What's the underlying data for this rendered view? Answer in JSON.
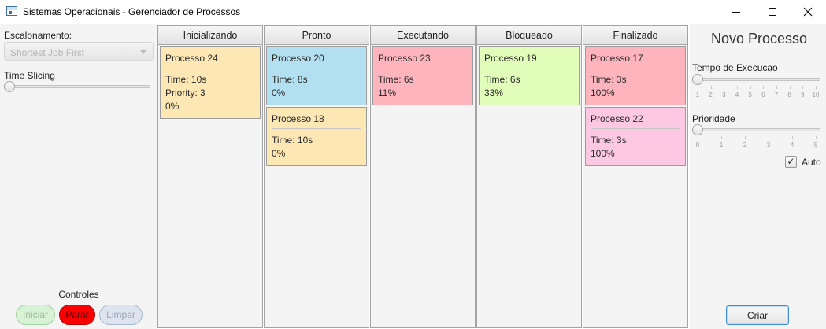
{
  "window": {
    "title": "Sistemas Operacionais - Gerenciador de Processos"
  },
  "left": {
    "scheduler_label": "Escalonamento:",
    "scheduler_value": "Shortest Job First",
    "time_slicing_label": "Time Slicing",
    "time_slicing_level": 0,
    "controls_label": "Controles",
    "buttons": {
      "start": "Iniciar",
      "stop": "Parar",
      "clear": "Limpar"
    }
  },
  "columns": [
    {
      "title": "Inicializando",
      "cards": [
        {
          "name": "Processo 24",
          "lines": [
            "Time: 10s",
            "Priority: 3",
            "0%"
          ],
          "color": "#fde8b5"
        }
      ]
    },
    {
      "title": "Pronto",
      "cards": [
        {
          "name": "Processo 20",
          "lines": [
            "Time: 8s",
            "0%"
          ],
          "color": "#b3e0f0"
        },
        {
          "name": "Processo 18",
          "lines": [
            "Time: 10s",
            "0%"
          ],
          "color": "#fde8b5"
        }
      ]
    },
    {
      "title": "Executando",
      "cards": [
        {
          "name": "Processo 23",
          "lines": [
            "Time: 6s",
            "11%"
          ],
          "color": "#fdb4bd"
        }
      ]
    },
    {
      "title": "Bloqueado",
      "cards": [
        {
          "name": "Processo 19",
          "lines": [
            "Time: 6s",
            "33%"
          ],
          "color": "#e2fdb9"
        }
      ]
    },
    {
      "title": "Finalizado",
      "cards": [
        {
          "name": "Processo 17",
          "lines": [
            "Time: 3s",
            "100%"
          ],
          "color": "#fdb4bd"
        },
        {
          "name": "Processo 22",
          "lines": [
            "Time: 3s",
            "100%"
          ],
          "color": "#fdc8e2"
        }
      ]
    }
  ],
  "right": {
    "title": "Novo Processo",
    "exec_time_label": "Tempo de Execucao",
    "exec_time_ticks": [
      "1",
      "2",
      "3",
      "4",
      "5",
      "6",
      "7",
      "8",
      "9",
      "10"
    ],
    "exec_time_value": 1,
    "priority_label": "Prioridade",
    "priority_ticks": [
      "0",
      "1",
      "2",
      "3",
      "4",
      "5"
    ],
    "priority_value": 0,
    "auto_label": "Auto",
    "auto_checked": true,
    "create_button": "Criar"
  }
}
